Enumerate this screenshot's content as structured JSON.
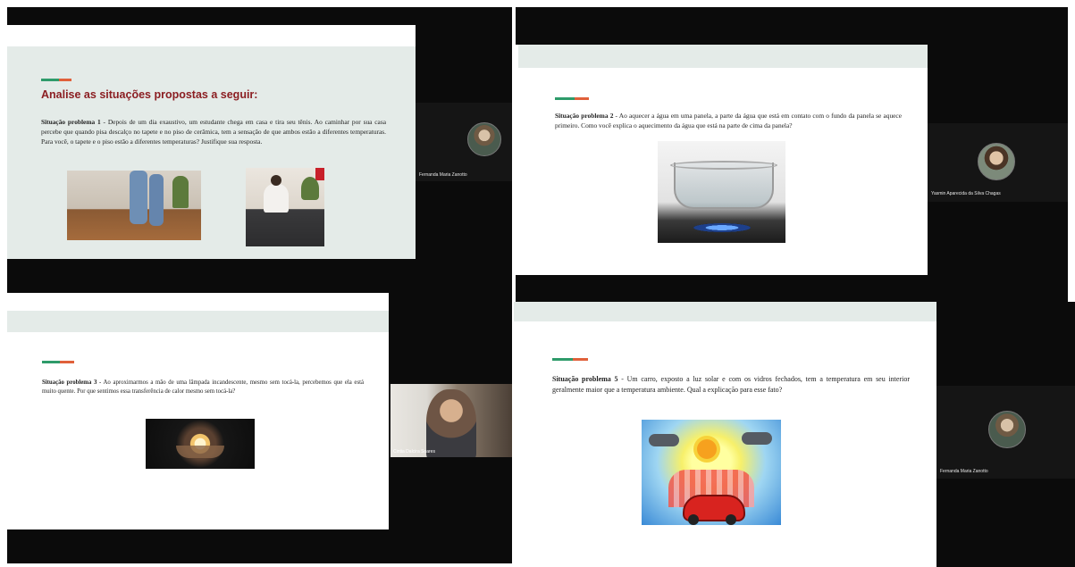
{
  "slides": {
    "s1": {
      "heading": "Analise as situações propostas a seguir:",
      "title": "Situação problema 1",
      "body": " - Depois de um dia exaustivo, um estudante chega em casa e tira seu tênis. Ao caminhar por sua casa percebe que quando pisa descalço no tapete e no piso de cerâmica, tem a sensação de que ambos estão a diferentes temperaturas. Para você, o tapete e o piso estão a diferentes temperaturas? Justifique sua resposta."
    },
    "s2": {
      "title": "Situação problema 2",
      "body": " - Ao aquecer a água em uma panela, a parte da água que está em contato com o fundo da panela se aquece primeiro. Como você explica o aquecimento da água que está na parte de cima da panela?"
    },
    "s3": {
      "title": "Situação problema 3",
      "body": " - Ao aproximarmos a mão de uma lâmpada incandescente, mesmo sem tocá-la, percebemos que ela está muito quente. Por que sentimos essa transferência de calor mesmo sem tocá-la?"
    },
    "s5": {
      "title": "Situação problema 5",
      "body": " - Um carro, exposto a luz solar e com os vidros fechados, tem a temperatura em seu interior geralmente maior que a temperatura ambiente. Qual a explicação para esse fato?"
    }
  },
  "participants": {
    "p1": "Fernanda Maria Zanotto",
    "p2": "Yasmin Aparecida da Silva Chagas",
    "p3": "Cintia Dalcira Soares",
    "p4": "Fernanda Maria Zanotto"
  },
  "colors": {
    "accent_green": "#2e9b6a",
    "accent_orange": "#e0603a",
    "heading_red": "#8b1e22"
  }
}
